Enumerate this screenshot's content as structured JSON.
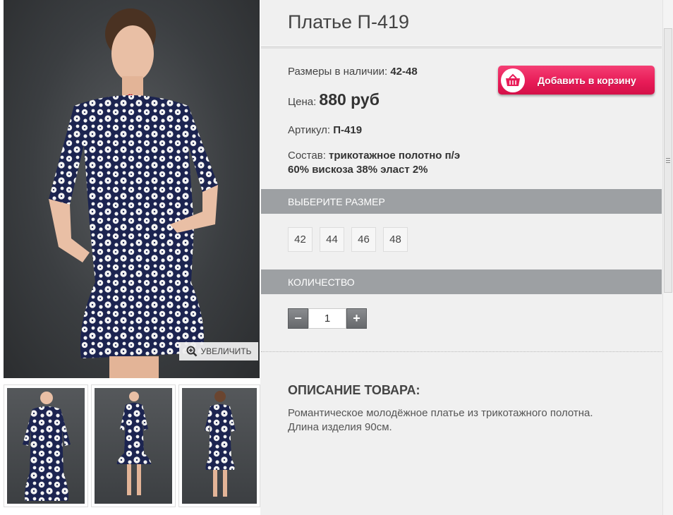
{
  "product": {
    "title": "Платье П-419",
    "sizes_label": "Размеры в наличии:",
    "sizes_value": "42-48",
    "price_label": "Цена:",
    "price_value": "880 руб",
    "sku_label": "Артикул:",
    "sku_value": "П-419",
    "composition_label": "Состав:",
    "composition_line1": "трикотажное полотно п/э",
    "composition_line2": "60% вискоза 38% эласт 2%"
  },
  "cart_button": {
    "label": "Добавить в корзину",
    "icon": "basket-icon",
    "color": "#e81c58"
  },
  "gallery": {
    "zoom_label": "УВЕЛИЧИТЬ",
    "zoom_icon": "magnifier-plus-icon"
  },
  "size_section": {
    "heading": "ВЫБЕРИТЕ РАЗМЕР",
    "options": [
      "42",
      "44",
      "46",
      "48"
    ]
  },
  "quantity_section": {
    "heading": "КОЛИЧЕСТВО",
    "minus": "−",
    "plus": "+",
    "value": "1"
  },
  "description": {
    "heading": "ОПИСАНИЕ ТОВАРА:",
    "line1": "Романтическое молодёжное платье из трикотажного полотна.",
    "line2": "Длина изделия 90см."
  },
  "colors": {
    "section_bar": "#9da0a3",
    "background": "#f0f0f0"
  }
}
